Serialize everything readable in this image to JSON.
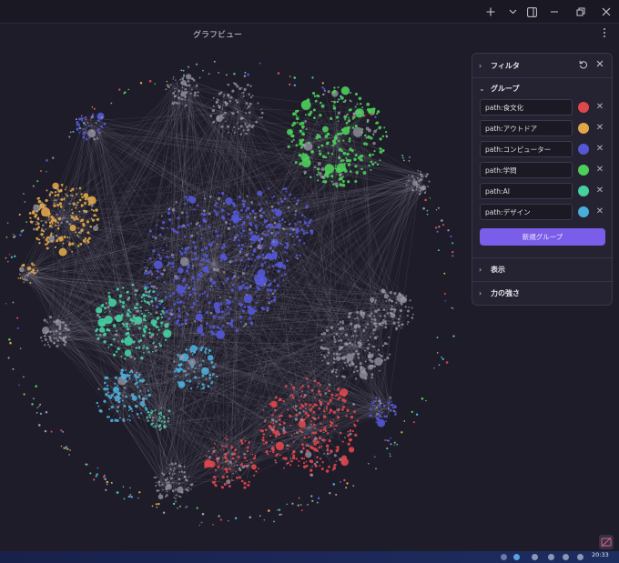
{
  "titlebar": {
    "new_tab_icon": "plus-icon",
    "dropdown_icon": "chevron-down-icon",
    "sidebar_icon": "sidebar-toggle-icon",
    "minimize_icon": "minimize-icon",
    "restore_icon": "restore-icon",
    "close_icon": "close-icon"
  },
  "view": {
    "title": "グラフビュー",
    "menu_icon": "more-vertical-icon"
  },
  "filter_panel": {
    "filter_label": "フィルタ",
    "reset_icon": "reset-icon",
    "close_icon": "close-icon",
    "groups_label": "グループ",
    "groups": [
      {
        "query": "path:食文化",
        "color": "#e0474c"
      },
      {
        "query": "path:アウトドア",
        "color": "#e0a648"
      },
      {
        "query": "path:コンピューター",
        "color": "#5458d6"
      },
      {
        "query": "path:学問",
        "color": "#4cd05a"
      },
      {
        "query": "path:AI",
        "color": "#45d0a0"
      },
      {
        "query": "path:デザイン",
        "color": "#4aaedc"
      }
    ],
    "new_group_label": "新規グループ",
    "display_label": "表示",
    "forces_label": "力の強さ"
  },
  "taskbar": {
    "clock": "20:33"
  },
  "colors": {
    "background": "#1e1c28",
    "node_default": "#9a9aa8",
    "edge": "#7c7a8a",
    "accent": "#7a5de8"
  }
}
